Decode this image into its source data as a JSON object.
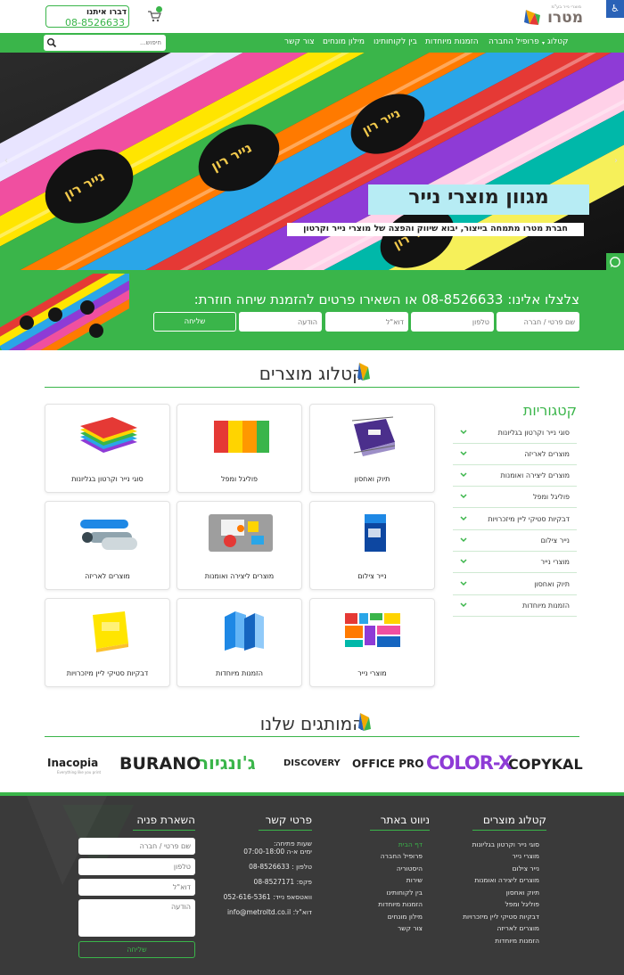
{
  "header": {
    "logo_text": "מטרו",
    "logo_tagline": "מוצרי נייר בע\"מ",
    "call_label": "דברו איתנו",
    "call_phone": "08-8526633"
  },
  "nav": {
    "items": [
      "קטלוג",
      "פרופיל החברה",
      "הזמנות מיוחדות",
      "בין לקוחותינו",
      "מילון מונחים",
      "צור קשר"
    ],
    "search_placeholder": "חיפוש..."
  },
  "hero": {
    "title": "מגוון מוצרי נייר",
    "subtitle": "חברת מטרו מתמחה בייצור, יבוא שיווק והפצה של מוצרי נייר וקרטון",
    "roll_labels": [
      "נייר רון",
      "נייר רון",
      "נייר רון",
      "נייר רון"
    ]
  },
  "contact_band": {
    "title": "צלצלו אלינו: 08-8526633 או השאירו פרטים להזמנת שיחה חוזרת:",
    "name_placeholder": "שם פרטי / חברה",
    "phone_placeholder": "טלפון",
    "email_placeholder": "דוא\"ל",
    "message_placeholder": "הודעה",
    "submit_label": "שליחה"
  },
  "catalog": {
    "title": "קטלוג מוצרים",
    "products": [
      "תיוק ואחסון",
      "פוליגל ומפל",
      "סוגי נייר וקרטון בגליונות",
      "נייר צילום",
      "מוצרים ליצירה ואומנות",
      "מוצרים לאריזה",
      "מוצרי נייר",
      "הזמנות מיוחדות",
      "דבקיות סטיקי ליין מיזכרויות"
    ],
    "categories_title": "קטגוריות",
    "categories": [
      "סוגי נייר וקרטון בגליונות",
      "מוצרים לאריזה",
      "מוצרים ליצירה ואומנות",
      "פוליגל ומפל",
      "דבקיות סטיקי ליין מיזכרויות",
      "נייר צילום",
      "מוצרי נייר",
      "תיוק ואחסון",
      "הזמנות מיוחדות"
    ]
  },
  "brands": {
    "title": "המותגים שלנו",
    "items": [
      "COPYKAL",
      "COLOR-X",
      "OFFICE PRO",
      "DISCOVERY",
      "ג'ונגיור",
      "BURANO",
      "Inacopia"
    ],
    "inacopia_tagline": "Everything like you print"
  },
  "footer": {
    "catalog_title": "קטלוג מוצרים",
    "catalog_links": [
      "סוגי נייר וקרטון בגליונות",
      "מוצרי נייר",
      "נייר צילום",
      "מוצרים ליצירה ואומנות",
      "תיוק ואחסון",
      "פוליגל ומפל",
      "דבקיות סטיקי ליין מיזכרויות",
      "מוצרים לאריזה",
      "הזמנות מיוחדות"
    ],
    "nav_title": "ניווט באתר",
    "nav_links": [
      "דף הבית",
      "פרופיל החברה",
      "היסטוריה",
      "שירות",
      "בין לקוחותינו",
      "הזמנות מיוחדות",
      "מילון מונחים",
      "צור קשר"
    ],
    "contact_title": "פרטי קשר",
    "hours_label": "שעות פתיחה:",
    "hours_value": "ימים א-ה 07:00-18:00",
    "phone": "טלפון : 08-8526633",
    "fax": "פקס: 08-8527171",
    "whatsapp": "וואטסאפ נייד: 052-616-5361",
    "email": "דוא\"ל: info@metroltd.co.il",
    "form_title": "השארת פניה",
    "form_name": "שם פרטי / חברה",
    "form_phone": "טלפון",
    "form_email": "דוא\"ל",
    "form_message": "הודעה",
    "form_submit": "שליחה"
  },
  "colors": {
    "accent_green": "#3ab54a",
    "footer_bg": "#3a3a3a",
    "hero_title_bg": "#b7ecf4"
  }
}
